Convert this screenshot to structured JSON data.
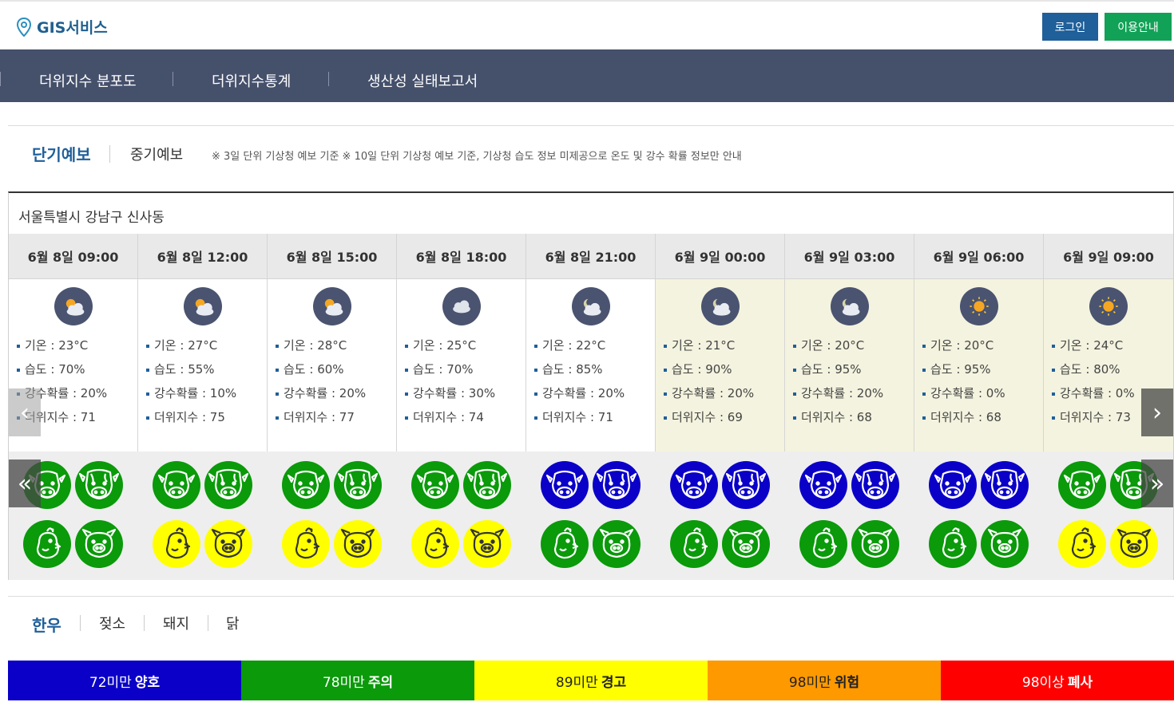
{
  "header": {
    "brand": "GIS서비스",
    "login": "로그인",
    "guide": "이용안내"
  },
  "nav": [
    "더위지수 분포도",
    "더위지수통계",
    "생산성 실태보고서"
  ],
  "tabs": {
    "short": "단기예보",
    "mid": "중기예보",
    "note": "※ 3일 단위 기상청 예보 기준   ※ 10일 단위 기상청 예보 기준, 기상청 습도 정보 미제공으로 온도 및 강수 확률 정보만 안내"
  },
  "location": "서울특별시 강남구 신사동",
  "slots": [
    {
      "time": "6월 8일 09:00",
      "weather": "partly-cloudy-day-icon",
      "temp": "기온 : 23°C",
      "hum": "습도 : 70%",
      "rain": "강수확률 : 20%",
      "thi": "더위지수 : 71",
      "cows": "green",
      "chick": "green",
      "pig": "green",
      "night": false
    },
    {
      "time": "6월 8일 12:00",
      "weather": "partly-cloudy-day-icon",
      "temp": "기온 : 27°C",
      "hum": "습도 : 55%",
      "rain": "강수확률 : 10%",
      "thi": "더위지수 : 75",
      "cows": "green",
      "chick": "yellow",
      "pig": "yellow",
      "night": false
    },
    {
      "time": "6월 8일 15:00",
      "weather": "partly-cloudy-day-icon",
      "temp": "기온 : 28°C",
      "hum": "습도 : 60%",
      "rain": "강수확률 : 20%",
      "thi": "더위지수 : 77",
      "cows": "green",
      "chick": "yellow",
      "pig": "yellow",
      "night": false
    },
    {
      "time": "6월 8일 18:00",
      "weather": "cloudy-icon",
      "temp": "기온 : 25°C",
      "hum": "습도 : 70%",
      "rain": "강수확률 : 30%",
      "thi": "더위지수 : 74",
      "cows": "green",
      "chick": "yellow",
      "pig": "yellow",
      "night": false
    },
    {
      "time": "6월 8일 21:00",
      "weather": "partly-cloudy-night-icon",
      "temp": "기온 : 22°C",
      "hum": "습도 : 85%",
      "rain": "강수확률 : 20%",
      "thi": "더위지수 : 71",
      "cows": "blue",
      "chick": "green",
      "pig": "green",
      "night": false
    },
    {
      "time": "6월 9일 00:00",
      "weather": "partly-cloudy-night-icon",
      "temp": "기온 : 21°C",
      "hum": "습도 : 90%",
      "rain": "강수확률 : 20%",
      "thi": "더위지수 : 69",
      "cows": "blue",
      "chick": "green",
      "pig": "green",
      "night": true
    },
    {
      "time": "6월 9일 03:00",
      "weather": "partly-cloudy-night-icon",
      "temp": "기온 : 20°C",
      "hum": "습도 : 95%",
      "rain": "강수확률 : 20%",
      "thi": "더위지수 : 68",
      "cows": "blue",
      "chick": "green",
      "pig": "green",
      "night": true
    },
    {
      "time": "6월 9일 06:00",
      "weather": "sunny-icon",
      "temp": "기온 : 20°C",
      "hum": "습도 : 95%",
      "rain": "강수확률 : 0%",
      "thi": "더위지수 : 68",
      "cows": "blue",
      "chick": "green",
      "pig": "green",
      "night": true
    },
    {
      "time": "6월 9일 09:00",
      "weather": "sunny-icon",
      "temp": "기온 : 24°C",
      "hum": "습도 : 80%",
      "rain": "강수확률 : 0%",
      "thi": "더위지수 : 73",
      "cows": "green",
      "chick": "yellow",
      "pig": "yellow",
      "night": true
    }
  ],
  "animal_tabs": [
    "한우",
    "젖소",
    "돼지",
    "닭"
  ],
  "legend": [
    {
      "prefix": "72미만",
      "level": "양호",
      "bg": "#0a00c8",
      "fg": "#ffffff"
    },
    {
      "prefix": "78미만",
      "level": "주의",
      "bg": "#0a9a0a",
      "fg": "#ffffff"
    },
    {
      "prefix": "89미만",
      "level": "경고",
      "bg": "#ffff00",
      "fg": "#222222"
    },
    {
      "prefix": "98미만",
      "level": "위험",
      "bg": "#ff9900",
      "fg": "#222222"
    },
    {
      "prefix": "98이상",
      "level": "폐사",
      "bg": "#ff0000",
      "fg": "#ffffff"
    }
  ],
  "arrows": {
    "prev": "‹",
    "next": "›",
    "prev_fast": "«",
    "next_fast": "»"
  }
}
